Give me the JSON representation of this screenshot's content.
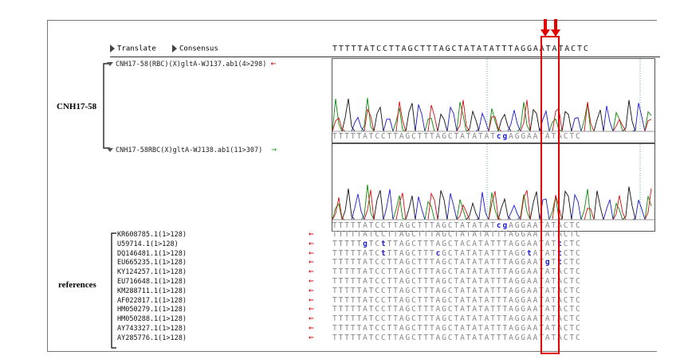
{
  "toolbar": {
    "translate_label": "Translate",
    "consensus_label": "Consensus",
    "consensus_sequence": "TTTTTATCCTTAGCTTTAGCTATATATTTAGGAATATACTC"
  },
  "groups": {
    "sample_label": "CNH17-58",
    "references_label": "references"
  },
  "traces": [
    {
      "name": "CNH17-58(RBC)(X)gltA-WJ137.ab1(4>298)",
      "arrow": "←",
      "arrow_color": "#d00000",
      "called_sequence": "TTTTTATCCTTAGCTTTAGCTATATATcgAGGAATATACTC"
    },
    {
      "name": "CNH17-58RBC(X)gltA-WJ138.ab1(11>307)",
      "arrow": "→",
      "arrow_color": "#19a019",
      "called_sequence": "TTTTTATCCTTAGCTTTAGCTATATATcgAGGAATATACTC"
    }
  ],
  "references": [
    {
      "name": "KR608785.1(1>128)",
      "arrow": "←",
      "sequence": "TTTTTATCCTTAGCTTTAGCTATATATTTAGGAATATACTC"
    },
    {
      "name": "U59714.1(1>128)",
      "arrow": "←",
      "sequence": "TTTTTgTCtTTAGCTTTAGCTACATATTTAGGAATATtCTC"
    },
    {
      "name": "DQ146481.1(1>128)",
      "arrow": "←",
      "sequence": "TTTTTATCtTTAGCTTTcGCTATATATTTAGGtATATtCTC"
    },
    {
      "name": "EU665235.1(1>128)",
      "arrow": "←",
      "sequence": "TTTTTATCCTTAGCTTTAGCTATATATTTAGGAATgTtCTC"
    },
    {
      "name": "KY124257.1(1>128)",
      "arrow": "←",
      "sequence": "TTTTTATCCTTAGCTTTAGCTATATATTTAGGAATATACTC"
    },
    {
      "name": "EU716648.1(1>128)",
      "arrow": "←",
      "sequence": "TTTTTATCCTTAGCTTTAGCTATATATTTAGGAATATACTC"
    },
    {
      "name": "KM288711.1(1>128)",
      "arrow": "←",
      "sequence": "TTTTTATCCTTAGCTTTAGCTATATATTTAGGAATATACTC"
    },
    {
      "name": "AF022817.1(1>128)",
      "arrow": "←",
      "sequence": "TTTTTATCCTTAGCTTTAGCTATATATTTAGGAATATACTC"
    },
    {
      "name": "HM050279.1(1>128)",
      "arrow": "←",
      "sequence": "TTTTTATCCTTAGCTTTAGCTATATATTTAGGAATATACTC"
    },
    {
      "name": "HM050288.1(1>128)",
      "arrow": "←",
      "sequence": "TTTTTATCCTTAGCTTTAGCTATATATTTAGGAATATACTC"
    },
    {
      "name": "AY743327.1(1>128)",
      "arrow": "←",
      "sequence": "TTTTTATCCTTAGCTTTAGCTATATATTTAGGAATATACTC"
    },
    {
      "name": "AY285776.1(1>128)",
      "arrow": "←",
      "sequence": "TTTTTATCCTTAGCTTTAGCTATATATTTAGGAATATACTC"
    }
  ],
  "colors": {
    "highlight": "#e00000",
    "trace_a": "#0a8a0a",
    "trace_c": "#1a1ad0",
    "trace_g": "#111111",
    "trace_t": "#d01010",
    "variant": "#1b1bd6",
    "guide_line": "#5aa0e0"
  }
}
